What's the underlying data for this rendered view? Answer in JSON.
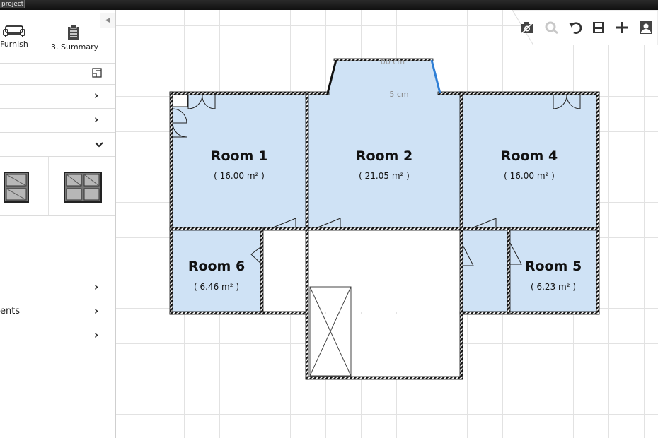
{
  "window": {
    "title_fragment": "project"
  },
  "sidebar": {
    "steps": [
      {
        "label": "Furnish",
        "icon": "sofa-icon"
      },
      {
        "label": "3. Summary",
        "icon": "clipboard-icon"
      }
    ],
    "rows": [
      {
        "label": "",
        "state": "collapsed"
      },
      {
        "label": "",
        "state": "collapsed"
      },
      {
        "label": "",
        "state": "expanded"
      },
      {
        "label": "",
        "state": "collapsed"
      },
      {
        "label": "ents",
        "state": "collapsed"
      },
      {
        "label": "",
        "state": "collapsed"
      }
    ],
    "window_items": [
      {
        "name": "single-window",
        "icon": "window-single-icon"
      },
      {
        "name": "double-window",
        "icon": "window-double-icon"
      }
    ]
  },
  "toolbar": {
    "buttons": [
      "camera-icon",
      "zoom-icon",
      "undo-icon",
      "save-icon",
      "add-icon",
      "account-icon"
    ]
  },
  "plan": {
    "rooms": [
      {
        "name": "Room 1",
        "area": "( 16.00 m² )"
      },
      {
        "name": "Room 2",
        "area": "( 21.05 m² )"
      },
      {
        "name": "Room 4",
        "area": "( 16.00 m² )"
      },
      {
        "name": "Room 6",
        "area": "( 6.46 m² )"
      },
      {
        "name": "Room 5",
        "area": "( 6.23 m² )"
      }
    ],
    "dimensions": [
      "00 cm",
      "5 cm"
    ],
    "colors": {
      "room_fill": "#cfe2f5",
      "wall": "#111111",
      "selection": "#2f7fd6"
    }
  }
}
